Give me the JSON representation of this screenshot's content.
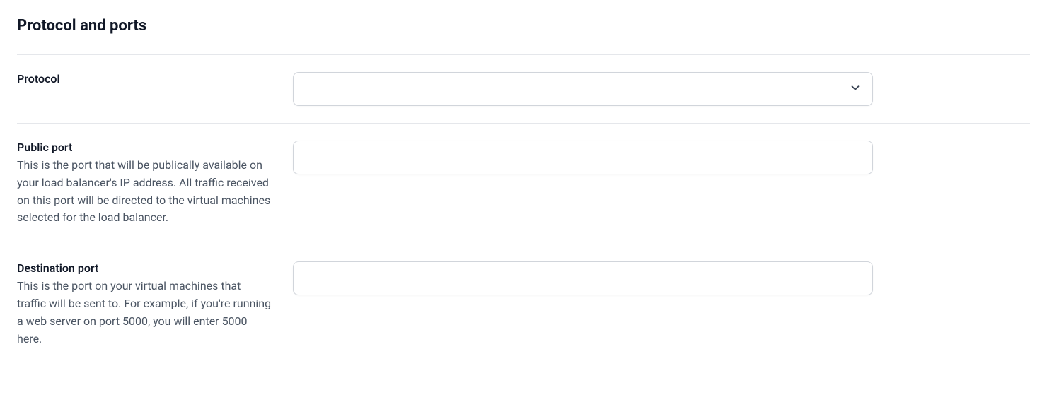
{
  "section": {
    "title": "Protocol and ports"
  },
  "fields": {
    "protocol": {
      "label": "Protocol",
      "value": ""
    },
    "public_port": {
      "label": "Public port",
      "description": "This is the port that will be publically available on your load balancer's IP address. All traffic received on this port will be directed to the virtual machines selected for the load balancer.",
      "value": ""
    },
    "destination_port": {
      "label": "Destination port",
      "description": "This is the port on your virtual machines that traffic will be sent to. For example, if you're running a web server on port 5000, you will enter 5000 here.",
      "value": ""
    }
  }
}
